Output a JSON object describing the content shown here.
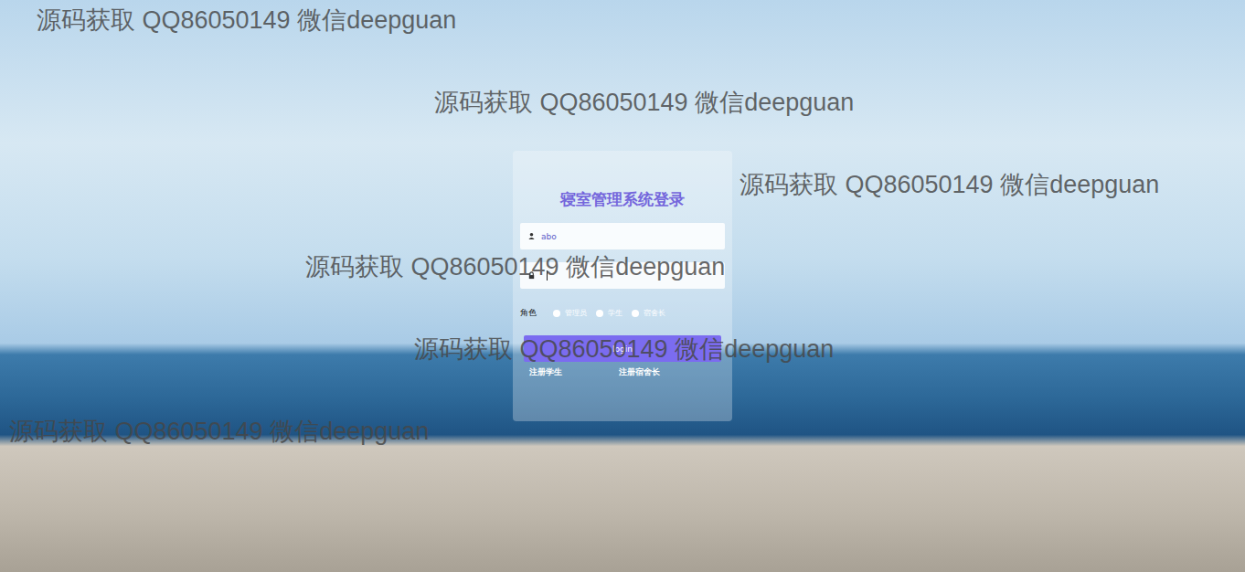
{
  "window": {
    "title": "寝室管理系统登录"
  },
  "form": {
    "username": {
      "value": "abo",
      "focused": false
    },
    "password": {
      "value": "",
      "focused": true
    }
  },
  "role": {
    "label": "角色",
    "options": [
      {
        "label": "管理员",
        "selected": false
      },
      {
        "label": "学生",
        "selected": false
      },
      {
        "label": "宿舍长",
        "selected": false
      }
    ]
  },
  "submit": "login",
  "links": [
    "注册学生",
    "注册宿舍长"
  ],
  "watermarks": [
    "源码获取 QQ86050149 微信deepguan",
    "源码获取 QQ86050149 微信deepguan",
    "源码获取 QQ86050149 微信deepguan",
    "源码获取 QQ86050149 微信deepguan",
    "源码获取 QQ86050149 微信deepguan",
    "源码获取 QQ86050149 微信deepguan"
  ]
}
